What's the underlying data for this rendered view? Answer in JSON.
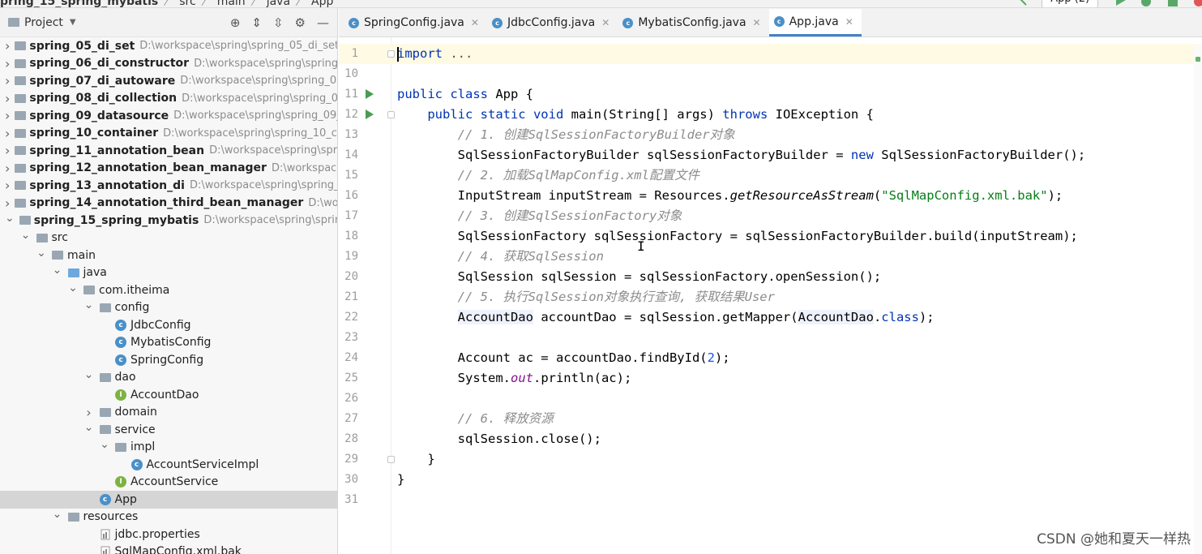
{
  "breadcrumb": {
    "items": [
      "pring_15_spring_mybatis",
      "src",
      "main",
      "java",
      "App"
    ],
    "separator": "〉"
  },
  "toolbar": {
    "run_config": "App (2)"
  },
  "project_panel": {
    "title": "Project",
    "tree": [
      {
        "label": "spring_05_di_set",
        "path": "D:\\workspace\\spring\\spring_05_di_set",
        "depth": 0,
        "expanded": false,
        "kind": "module"
      },
      {
        "label": "spring_06_di_constructor",
        "path": "D:\\workspace\\spring\\spring_",
        "depth": 0,
        "expanded": false,
        "kind": "module"
      },
      {
        "label": "spring_07_di_autoware",
        "path": "D:\\workspace\\spring\\spring_07",
        "depth": 0,
        "expanded": false,
        "kind": "module"
      },
      {
        "label": "spring_08_di_collection",
        "path": "D:\\workspace\\spring\\spring_08",
        "depth": 0,
        "expanded": false,
        "kind": "module"
      },
      {
        "label": "spring_09_datasource",
        "path": "D:\\workspace\\spring\\spring_09_c",
        "depth": 0,
        "expanded": false,
        "kind": "module"
      },
      {
        "label": "spring_10_container",
        "path": "D:\\workspace\\spring\\spring_10_co",
        "depth": 0,
        "expanded": false,
        "kind": "module"
      },
      {
        "label": "spring_11_annotation_bean",
        "path": "D:\\workspace\\spring\\sprin",
        "depth": 0,
        "expanded": false,
        "kind": "module"
      },
      {
        "label": "spring_12_annotation_bean_manager",
        "path": "D:\\workspace\\sp",
        "depth": 0,
        "expanded": false,
        "kind": "module"
      },
      {
        "label": "spring_13_annotation_di",
        "path": "D:\\workspace\\spring\\spring_1",
        "depth": 0,
        "expanded": false,
        "kind": "module"
      },
      {
        "label": "spring_14_annotation_third_bean_manager",
        "path": "D:\\worksp",
        "depth": 0,
        "expanded": false,
        "kind": "module"
      },
      {
        "label": "spring_15_spring_mybatis",
        "path": "D:\\workspace\\spring\\spring",
        "depth": 0,
        "expanded": true,
        "kind": "module"
      },
      {
        "label": "src",
        "path": "",
        "depth": 1,
        "expanded": true,
        "kind": "folder"
      },
      {
        "label": "main",
        "path": "",
        "depth": 2,
        "expanded": true,
        "kind": "folder"
      },
      {
        "label": "java",
        "path": "",
        "depth": 3,
        "expanded": true,
        "kind": "source"
      },
      {
        "label": "com.itheima",
        "path": "",
        "depth": 4,
        "expanded": true,
        "kind": "package"
      },
      {
        "label": "config",
        "path": "",
        "depth": 5,
        "expanded": true,
        "kind": "package"
      },
      {
        "label": "JdbcConfig",
        "path": "",
        "depth": 6,
        "expanded": null,
        "kind": "class"
      },
      {
        "label": "MybatisConfig",
        "path": "",
        "depth": 6,
        "expanded": null,
        "kind": "class"
      },
      {
        "label": "SpringConfig",
        "path": "",
        "depth": 6,
        "expanded": null,
        "kind": "class"
      },
      {
        "label": "dao",
        "path": "",
        "depth": 5,
        "expanded": true,
        "kind": "package"
      },
      {
        "label": "AccountDao",
        "path": "",
        "depth": 6,
        "expanded": null,
        "kind": "interface"
      },
      {
        "label": "domain",
        "path": "",
        "depth": 5,
        "expanded": false,
        "kind": "package"
      },
      {
        "label": "service",
        "path": "",
        "depth": 5,
        "expanded": true,
        "kind": "package"
      },
      {
        "label": "impl",
        "path": "",
        "depth": 6,
        "expanded": true,
        "kind": "package"
      },
      {
        "label": "AccountServiceImpl",
        "path": "",
        "depth": 7,
        "expanded": null,
        "kind": "class"
      },
      {
        "label": "AccountService",
        "path": "",
        "depth": 6,
        "expanded": null,
        "kind": "interface"
      },
      {
        "label": "App",
        "path": "",
        "depth": 5,
        "expanded": null,
        "kind": "class-run",
        "selected": true
      },
      {
        "label": "resources",
        "path": "",
        "depth": 3,
        "expanded": true,
        "kind": "resources"
      },
      {
        "label": "jdbc.properties",
        "path": "",
        "depth": 5,
        "expanded": null,
        "kind": "file"
      },
      {
        "label": "SqlMapConfig.xml.bak",
        "path": "",
        "depth": 5,
        "expanded": null,
        "kind": "file"
      }
    ]
  },
  "tabs": [
    {
      "label": "SpringConfig.java",
      "active": false
    },
    {
      "label": "JdbcConfig.java",
      "active": false
    },
    {
      "label": "MybatisConfig.java",
      "active": false
    },
    {
      "label": "App.java",
      "active": true
    }
  ],
  "code_lines": [
    {
      "num": "1",
      "fold": true,
      "run": false,
      "current": true,
      "caret": true,
      "tokens": [
        {
          "t": "import",
          "c": "kw"
        },
        {
          "t": " ...",
          "c": "cm-plain"
        }
      ]
    },
    {
      "num": "10",
      "fold": false,
      "run": false,
      "tokens": []
    },
    {
      "num": "11",
      "fold": false,
      "run": true,
      "tokens": [
        {
          "t": "public class ",
          "c": "kw"
        },
        {
          "t": "App {",
          "c": ""
        }
      ]
    },
    {
      "num": "12",
      "fold": true,
      "run": true,
      "tokens": [
        {
          "t": "    public static void ",
          "c": "kw"
        },
        {
          "t": "main(String[] args) ",
          "c": ""
        },
        {
          "t": "throws ",
          "c": "kw"
        },
        {
          "t": "IOException {",
          "c": ""
        }
      ]
    },
    {
      "num": "13",
      "fold": false,
      "run": false,
      "tokens": [
        {
          "t": "        // 1. 创建SqlSessionFactoryBuilder对象",
          "c": "cm"
        }
      ]
    },
    {
      "num": "14",
      "fold": false,
      "run": false,
      "tokens": [
        {
          "t": "        SqlSessionFactoryBuilder sqlSessionFactoryBuilder = ",
          "c": ""
        },
        {
          "t": "new ",
          "c": "kw"
        },
        {
          "t": "SqlSessionFactoryBuilder();",
          "c": ""
        }
      ]
    },
    {
      "num": "15",
      "fold": false,
      "run": false,
      "tokens": [
        {
          "t": "        // 2. 加载SqlMapConfig.xml配置文件",
          "c": "cm"
        }
      ]
    },
    {
      "num": "16",
      "fold": false,
      "run": false,
      "tokens": [
        {
          "t": "        InputStream inputStream = Resources.",
          "c": ""
        },
        {
          "t": "getResourceAsStream",
          "c": "it"
        },
        {
          "t": "(",
          "c": ""
        },
        {
          "t": "\"SqlMapConfig.xml.bak\"",
          "c": "st"
        },
        {
          "t": ");",
          "c": ""
        }
      ]
    },
    {
      "num": "17",
      "fold": false,
      "run": false,
      "tokens": [
        {
          "t": "        // 3. 创建SqlSessionFactory对象",
          "c": "cm"
        }
      ]
    },
    {
      "num": "18",
      "fold": false,
      "run": false,
      "tokens": [
        {
          "t": "        SqlSessionFactory sqlSessionFactory = sqlSessionFactoryBuilder.build(inputStream);",
          "c": ""
        }
      ]
    },
    {
      "num": "19",
      "fold": false,
      "run": false,
      "tokens": [
        {
          "t": "        // 4. 获取SqlSession",
          "c": "cm"
        }
      ]
    },
    {
      "num": "20",
      "fold": false,
      "run": false,
      "tokens": [
        {
          "t": "        SqlSession sqlSession = sqlSessionFactory.openSession();",
          "c": ""
        }
      ]
    },
    {
      "num": "21",
      "fold": false,
      "run": false,
      "tokens": [
        {
          "t": "        // 5. 执行SqlSession对象执行查询, 获取结果User",
          "c": "cm"
        }
      ]
    },
    {
      "num": "22",
      "fold": false,
      "run": false,
      "tokens": [
        {
          "t": "        ",
          "c": ""
        },
        {
          "t": "AccountDao",
          "c": "hl"
        },
        {
          "t": " accountDao = sqlSession.getMapper(",
          "c": ""
        },
        {
          "t": "AccountDao",
          "c": "hl"
        },
        {
          "t": ".",
          "c": ""
        },
        {
          "t": "class",
          "c": "kw"
        },
        {
          "t": ");",
          "c": ""
        }
      ]
    },
    {
      "num": "23",
      "fold": false,
      "run": false,
      "tokens": []
    },
    {
      "num": "24",
      "fold": false,
      "run": false,
      "tokens": [
        {
          "t": "        Account ac = accountDao.findById(",
          "c": ""
        },
        {
          "t": "2",
          "c": "num"
        },
        {
          "t": ");",
          "c": ""
        }
      ]
    },
    {
      "num": "25",
      "fold": false,
      "run": false,
      "tokens": [
        {
          "t": "        System.",
          "c": ""
        },
        {
          "t": "out",
          "c": "fd"
        },
        {
          "t": ".println(ac);",
          "c": ""
        }
      ]
    },
    {
      "num": "26",
      "fold": false,
      "run": false,
      "tokens": []
    },
    {
      "num": "27",
      "fold": false,
      "run": false,
      "tokens": [
        {
          "t": "        // 6. 释放资源",
          "c": "cm"
        }
      ]
    },
    {
      "num": "28",
      "fold": false,
      "run": false,
      "tokens": [
        {
          "t": "        sqlSession.close();",
          "c": ""
        }
      ]
    },
    {
      "num": "29",
      "fold": true,
      "run": false,
      "tokens": [
        {
          "t": "    }",
          "c": ""
        }
      ]
    },
    {
      "num": "30",
      "fold": false,
      "run": false,
      "tokens": [
        {
          "t": "}",
          "c": ""
        }
      ]
    },
    {
      "num": "31",
      "fold": false,
      "run": false,
      "tokens": []
    }
  ],
  "watermark": "CSDN @她和夏天一样热"
}
